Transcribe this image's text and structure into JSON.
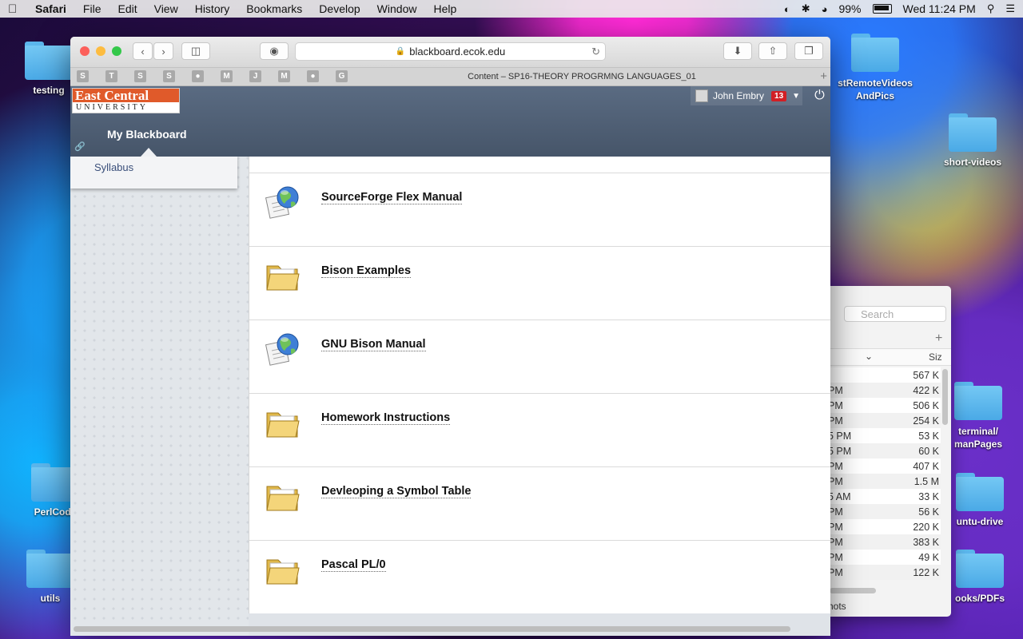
{
  "menubar": {
    "apple": "",
    "app": "Safari",
    "items": [
      "File",
      "Edit",
      "View",
      "History",
      "Bookmarks",
      "Develop",
      "Window",
      "Help"
    ],
    "battery_pct": "99%",
    "clock": "Wed 11:24 PM"
  },
  "desktop": {
    "icons": [
      "testing",
      "stRemoteVideos\nAndPics",
      "short-videos",
      "terminal/\nmanPages",
      "PerlCode",
      "untu-drive",
      "utils",
      "ooks/PDFs"
    ]
  },
  "finder": {
    "search_placeholder": "Search",
    "size_header": "Siz",
    "rows": [
      {
        "t": "",
        "s": "567 K"
      },
      {
        "t": "PM",
        "s": "422 K"
      },
      {
        "t": "PM",
        "s": "506 K"
      },
      {
        "t": "PM",
        "s": "254 K"
      },
      {
        "t": "5 PM",
        "s": "53 K"
      },
      {
        "t": "5 PM",
        "s": "60 K"
      },
      {
        "t": "PM",
        "s": "407 K"
      },
      {
        "t": "PM",
        "s": "1.5 M"
      },
      {
        "t": "5 AM",
        "s": "33 K"
      },
      {
        "t": "PM",
        "s": "56 K"
      },
      {
        "t": "PM",
        "s": "220 K"
      },
      {
        "t": "PM",
        "s": "383 K"
      },
      {
        "t": "PM",
        "s": "49 K"
      },
      {
        "t": "PM",
        "s": "122 K"
      }
    ],
    "footer": "hots"
  },
  "safari": {
    "url": "blackboard.ecok.edu",
    "favorites": [
      "S",
      "T",
      "S",
      "S",
      "",
      "M",
      "J",
      "M",
      "",
      "G"
    ],
    "tab_title": "Content – SP16-THEORY PROGRMNG LANGUAGES_01"
  },
  "blackboard": {
    "logo_top": "East Central",
    "logo_bottom": "UNIVERSITY",
    "user_name": "John Embry",
    "notification_count": "13",
    "my_blackboard": "My Blackboard",
    "menu_link": "Syllabus",
    "items": [
      {
        "title": "SourceForge Flex Manual",
        "icon": "web-link"
      },
      {
        "title": "Bison Examples",
        "icon": "folder"
      },
      {
        "title": "GNU Bison Manual",
        "icon": "web-link"
      },
      {
        "title": "Homework Instructions",
        "icon": "folder"
      },
      {
        "title": "Devleoping a Symbol Table",
        "icon": "folder"
      },
      {
        "title": "Pascal PL/0",
        "icon": "folder"
      }
    ]
  }
}
